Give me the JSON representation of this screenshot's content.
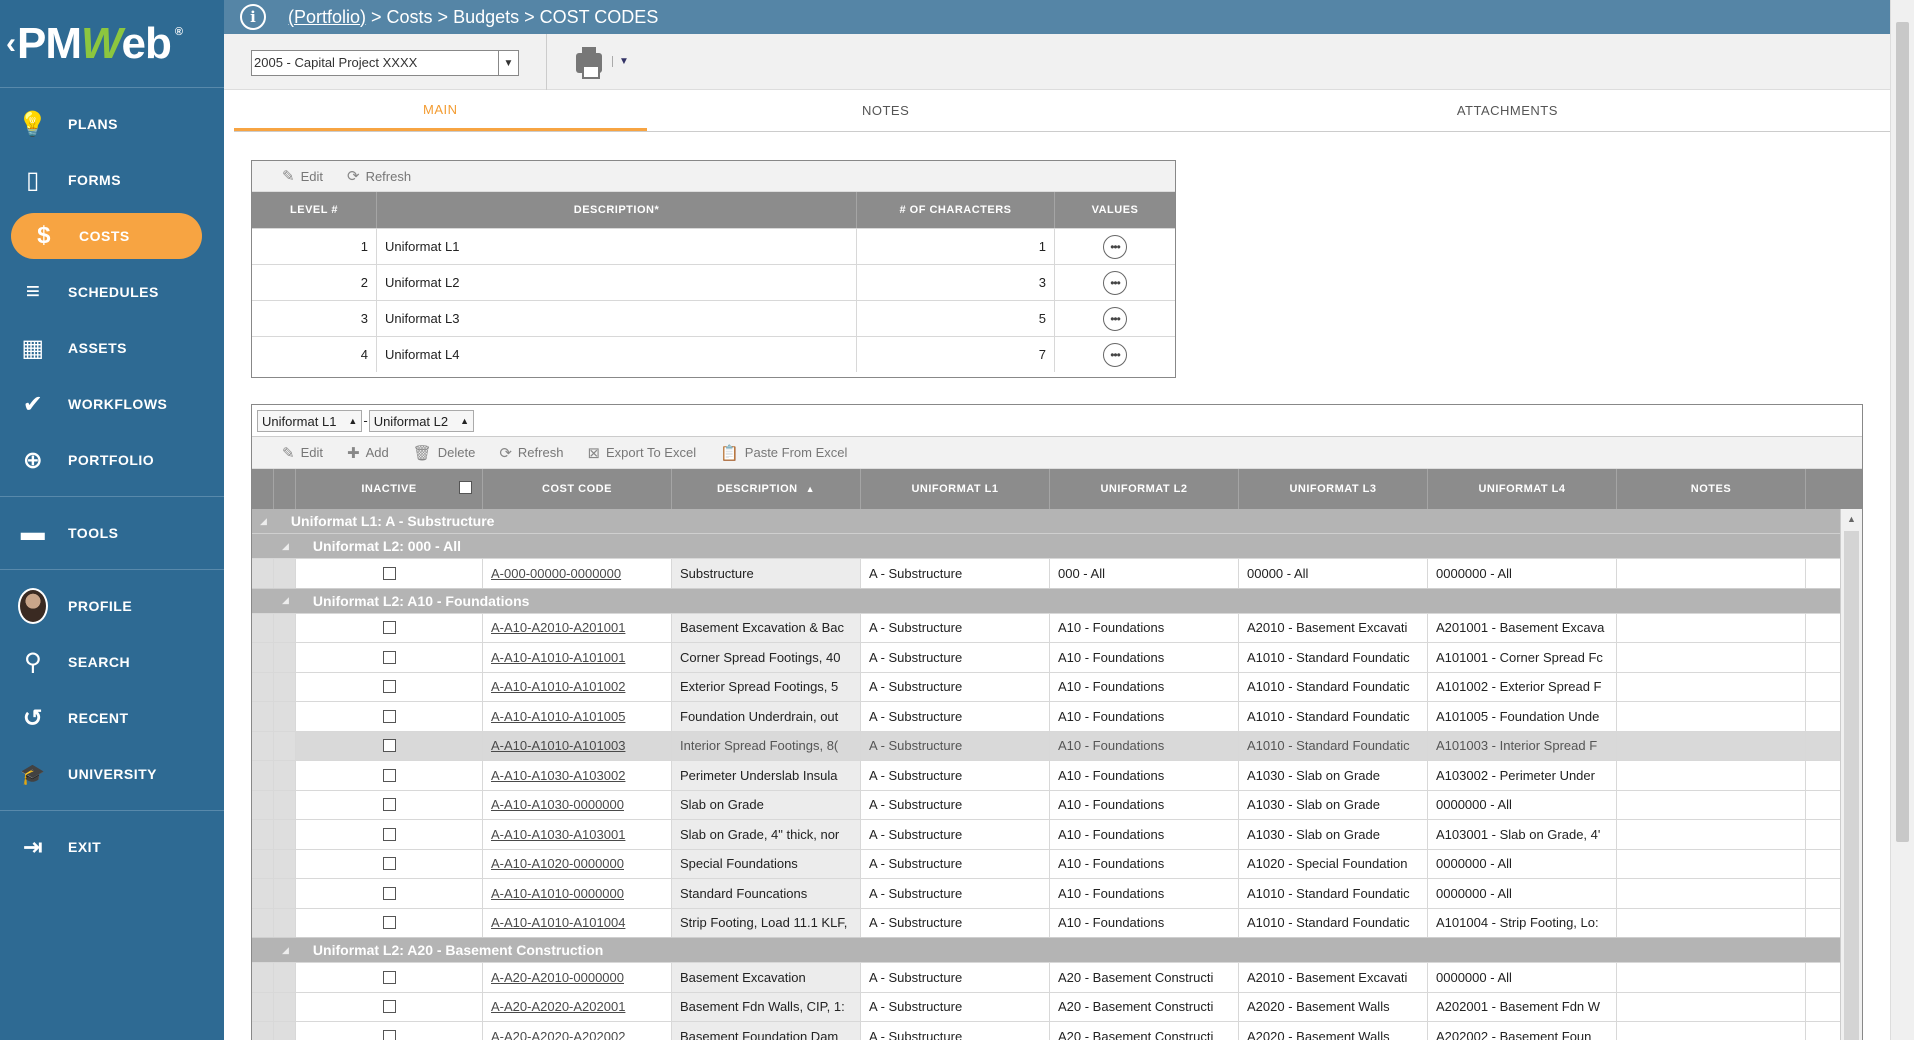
{
  "logo": {
    "text_pm": "PM",
    "text_w": "W",
    "text_eb": "eb",
    "reg": "®"
  },
  "sidebar": {
    "items": [
      {
        "label": "PLANS",
        "icon": "bulb-icon",
        "glyph": "💡"
      },
      {
        "label": "FORMS",
        "icon": "form-icon",
        "glyph": "▯"
      },
      {
        "label": "COSTS",
        "icon": "dollar-icon",
        "glyph": "$",
        "active": true
      },
      {
        "label": "SCHEDULES",
        "icon": "schedule-icon",
        "glyph": "≡"
      },
      {
        "label": "ASSETS",
        "icon": "building-icon",
        "glyph": "▦"
      },
      {
        "label": "WORKFLOWS",
        "icon": "check-icon",
        "glyph": "✔"
      },
      {
        "label": "PORTFOLIO",
        "icon": "globe-icon",
        "glyph": "⊕"
      }
    ],
    "tools": {
      "label": "TOOLS",
      "icon": "toolbox-icon",
      "glyph": "▬"
    },
    "profile": {
      "label": "PROFILE"
    },
    "search": {
      "label": "SEARCH",
      "glyph": "⚲"
    },
    "recent": {
      "label": "RECENT",
      "glyph": "↺"
    },
    "university": {
      "label": "UNIVERSITY",
      "glyph": "🎓"
    },
    "exit": {
      "label": "EXIT",
      "glyph": "⇥"
    }
  },
  "header": {
    "info": "i",
    "crumb_portfolio": "(Portfolio)",
    "crumb_rest": " > Costs > Budgets > COST CODES"
  },
  "project": {
    "selected": "2005 - Capital Project XXXX"
  },
  "tabs": [
    "MAIN",
    "NOTES",
    "ATTACHMENTS"
  ],
  "levels": {
    "toolbar": {
      "edit": "Edit",
      "refresh": "Refresh"
    },
    "headers": [
      "LEVEL #",
      "DESCRIPTION*",
      "# OF CHARACTERS",
      "VALUES"
    ],
    "rows": [
      {
        "level": "1",
        "description": "Uniformat L1",
        "chars": "1"
      },
      {
        "level": "2",
        "description": "Uniformat L2",
        "chars": "3"
      },
      {
        "level": "3",
        "description": "Uniformat L3",
        "chars": "5"
      },
      {
        "level": "4",
        "description": "Uniformat L4",
        "chars": "7"
      }
    ]
  },
  "codes": {
    "group_chips": [
      "Uniformat L1",
      "Uniformat L2"
    ],
    "toolbar": {
      "edit": "Edit",
      "add": "Add",
      "delete": "Delete",
      "refresh": "Refresh",
      "export": "Export To Excel",
      "paste": "Paste From Excel"
    },
    "headers": [
      "INACTIVE",
      "COST CODE",
      "DESCRIPTION",
      "UNIFORMAT L1",
      "UNIFORMAT L2",
      "UNIFORMAT L3",
      "UNIFORMAT L4",
      "NOTES"
    ],
    "group_l1": "Uniformat L1: A - Substructure",
    "groups": [
      {
        "title": "Uniformat L2: 000 - All",
        "rows": [
          {
            "code": "A-000-00000-0000000",
            "desc": "Substructure",
            "l1": "A - Substructure",
            "l2": "000 - All",
            "l3": "00000 - All",
            "l4": "0000000 - All"
          }
        ]
      },
      {
        "title": "Uniformat L2: A10 - Foundations",
        "rows": [
          {
            "code": "A-A10-A2010-A201001",
            "desc": "Basement Excavation & Bac",
            "l1": "A - Substructure",
            "l2": "A10 - Foundations",
            "l3": "A2010 - Basement Excavati",
            "l4": "A201001 - Basement Excava"
          },
          {
            "code": "A-A10-A1010-A101001",
            "desc": "Corner Spread Footings, 40",
            "l1": "A - Substructure",
            "l2": "A10 - Foundations",
            "l3": "A1010 - Standard Foundatic",
            "l4": "A101001 - Corner Spread Fc"
          },
          {
            "code": "A-A10-A1010-A101002",
            "desc": "Exterior Spread Footings, 5",
            "l1": "A - Substructure",
            "l2": "A10 - Foundations",
            "l3": "A1010 - Standard Foundatic",
            "l4": "A101002 - Exterior Spread F"
          },
          {
            "code": "A-A10-A1010-A101005",
            "desc": "Foundation Underdrain, out",
            "l1": "A - Substructure",
            "l2": "A10 - Foundations",
            "l3": "A1010 - Standard Foundatic",
            "l4": "A101005 - Foundation Unde"
          },
          {
            "code": "A-A10-A1010-A101003",
            "desc": "Interior Spread Footings, 8(",
            "l1": "A - Substructure",
            "l2": "A10 - Foundations",
            "l3": "A1010 - Standard Foundatic",
            "l4": "A101003 - Interior Spread F",
            "selected": true
          },
          {
            "code": "A-A10-A1030-A103002",
            "desc": "Perimeter Underslab Insula",
            "l1": "A - Substructure",
            "l2": "A10 - Foundations",
            "l3": "A1030 - Slab on Grade",
            "l4": "A103002 - Perimeter Under"
          },
          {
            "code": "A-A10-A1030-0000000",
            "desc": "Slab on Grade",
            "l1": "A - Substructure",
            "l2": "A10 - Foundations",
            "l3": "A1030 - Slab on Grade",
            "l4": "0000000 - All"
          },
          {
            "code": "A-A10-A1030-A103001",
            "desc": "Slab on Grade, 4\" thick, nor",
            "l1": "A - Substructure",
            "l2": "A10 - Foundations",
            "l3": "A1030 - Slab on Grade",
            "l4": "A103001 - Slab on Grade, 4'"
          },
          {
            "code": "A-A10-A1020-0000000",
            "desc": "Special Foundations",
            "l1": "A - Substructure",
            "l2": "A10 - Foundations",
            "l3": "A1020 - Special Foundation",
            "l4": "0000000 - All"
          },
          {
            "code": "A-A10-A1010-0000000",
            "desc": "Standard Founcations",
            "l1": "A - Substructure",
            "l2": "A10 - Foundations",
            "l3": "A1010 - Standard Foundatic",
            "l4": "0000000 - All"
          },
          {
            "code": "A-A10-A1010-A101004",
            "desc": "Strip Footing, Load 11.1 KLF,",
            "l1": "A - Substructure",
            "l2": "A10 - Foundations",
            "l3": "A1010 - Standard Foundatic",
            "l4": "A101004 - Strip Footing, Lo:"
          }
        ]
      },
      {
        "title": "Uniformat L2: A20 - Basement Construction",
        "rows": [
          {
            "code": "A-A20-A2010-0000000",
            "desc": "Basement Excavation",
            "l1": "A - Substructure",
            "l2": "A20 - Basement Constructi",
            "l3": "A2010 - Basement Excavati",
            "l4": "0000000 - All"
          },
          {
            "code": "A-A20-A2020-A202001",
            "desc": "Basement Fdn Walls, CIP, 1:",
            "l1": "A - Substructure",
            "l2": "A20 - Basement Constructi",
            "l3": "A2020 - Basement Walls",
            "l4": "A202001 - Basement Fdn W"
          },
          {
            "code": "A-A20-A2020-A202002",
            "desc": "Basement Foundation Dam",
            "l1": "A - Substructure",
            "l2": "A20 - Basement Constructi",
            "l3": "A2020 - Basement Walls",
            "l4": "A202002 - Basement Foun"
          }
        ]
      }
    ]
  }
}
